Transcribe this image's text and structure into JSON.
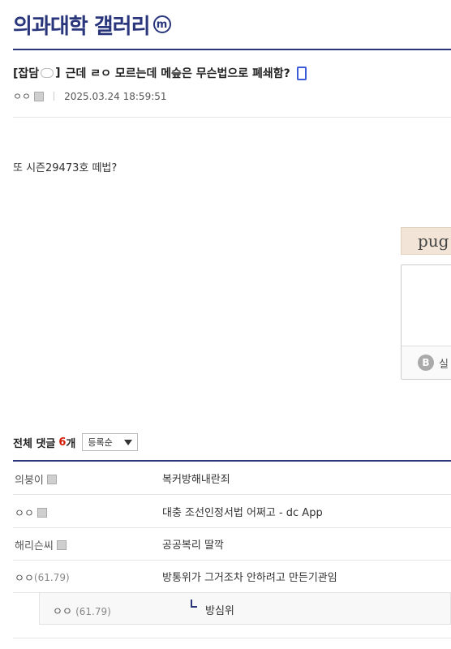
{
  "gallery": {
    "title": "의과대학 갤러리",
    "badge": "m"
  },
  "post": {
    "head": "[잡담",
    "head_close": "]",
    "title": "근데 ㄹㅇ 모르는데 메슾은 무슨법으로 폐쇄함?",
    "author": "ㅇㅇ",
    "date": "2025.03.24 18:59:51",
    "body": "또 시즌29473호 떼법?"
  },
  "captcha": {
    "text": "pug",
    "label": "실"
  },
  "comments_header": {
    "label": "전체 댓글",
    "count": "6",
    "unit": "개",
    "sort": "등록순"
  },
  "comments": [
    {
      "nick": "의붕이",
      "ip": "",
      "text": "복커방해내란죄"
    },
    {
      "nick": "ㅇㅇ",
      "ip": "",
      "text": "대충 조선인정서법 어쩌고 - dc App"
    },
    {
      "nick": "해리슨씨",
      "ip": "",
      "text": "공공복리 딸깍"
    },
    {
      "nick": "ㅇㅇ",
      "ip": "(61.79)",
      "text": "방통위가 그거조차 안하려고 만든기관임"
    }
  ],
  "reply": {
    "nick": "ㅇㅇ",
    "ip": "(61.79)",
    "text": "방심위"
  }
}
